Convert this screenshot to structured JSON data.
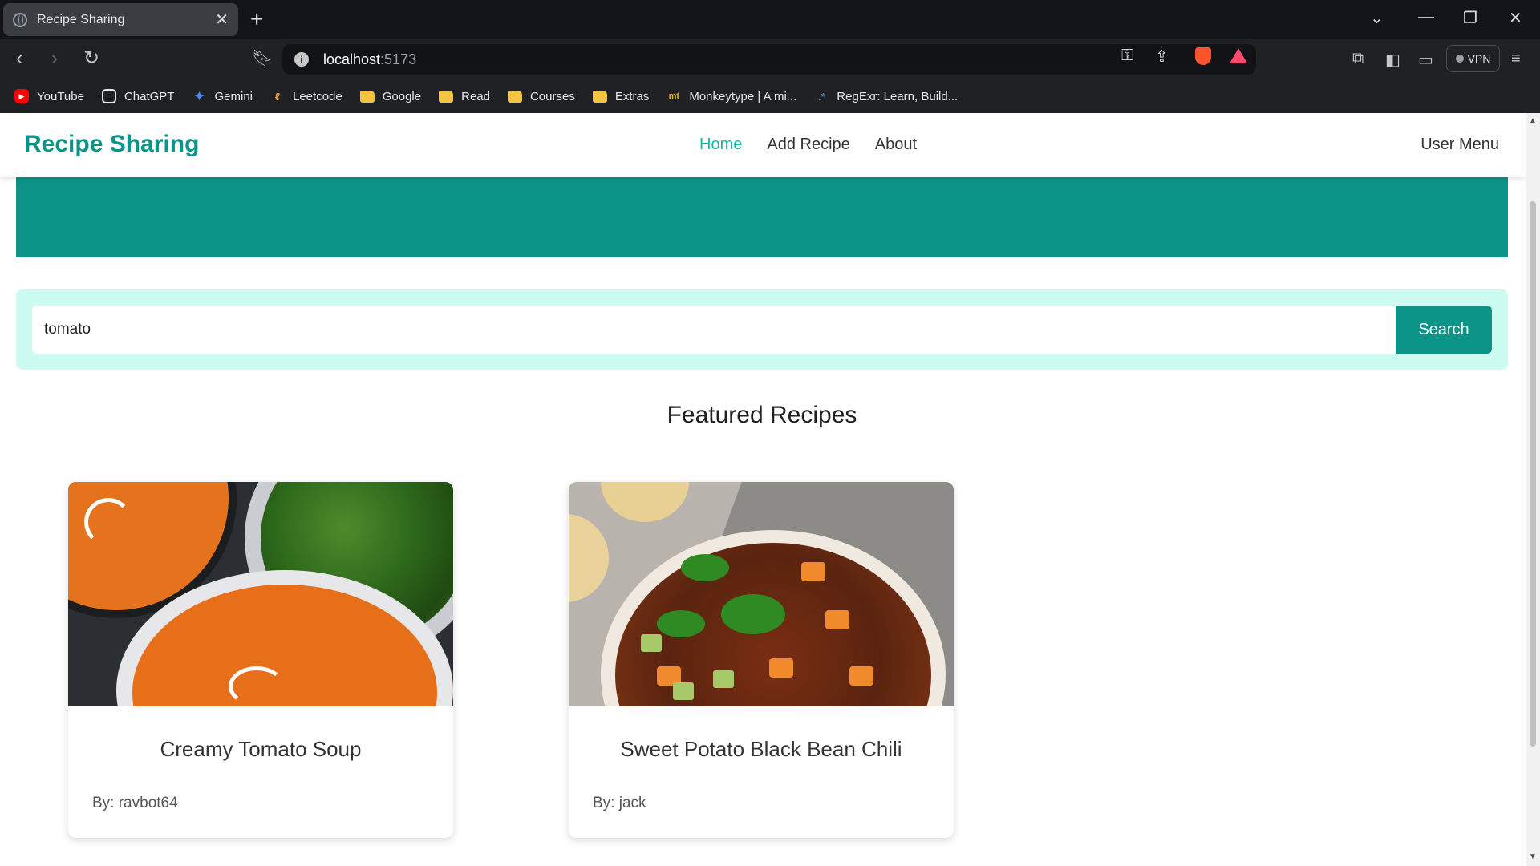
{
  "browser": {
    "tab_title": "Recipe Sharing",
    "url_host": "localhost",
    "url_port": ":5173",
    "vpn_label": "VPN",
    "bookmarks": [
      {
        "label": "YouTube",
        "icon": "youtube-icon"
      },
      {
        "label": "ChatGPT",
        "icon": "chatgpt-icon"
      },
      {
        "label": "Gemini",
        "icon": "gemini-icon"
      },
      {
        "label": "Leetcode",
        "icon": "leetcode-icon"
      },
      {
        "label": "Google",
        "icon": "folder-icon"
      },
      {
        "label": "Read",
        "icon": "folder-icon"
      },
      {
        "label": "Courses",
        "icon": "folder-icon"
      },
      {
        "label": "Extras",
        "icon": "folder-icon"
      },
      {
        "label": "Monkeytype | A mi...",
        "icon": "monkeytype-icon"
      },
      {
        "label": "RegExr: Learn, Build...",
        "icon": "regexr-icon"
      }
    ]
  },
  "app": {
    "brand": "Recipe Sharing",
    "nav": {
      "home": "Home",
      "add_recipe": "Add Recipe",
      "about": "About"
    },
    "user_menu": "User Menu",
    "accent_color": "#0d9488",
    "search": {
      "value": "tomato",
      "button": "Search"
    },
    "featured_heading": "Featured Recipes",
    "recipes": [
      {
        "title": "Creamy Tomato Soup",
        "author": "By: ravbot64"
      },
      {
        "title": "Sweet Potato Black Bean Chili",
        "author": "By: jack"
      }
    ]
  }
}
